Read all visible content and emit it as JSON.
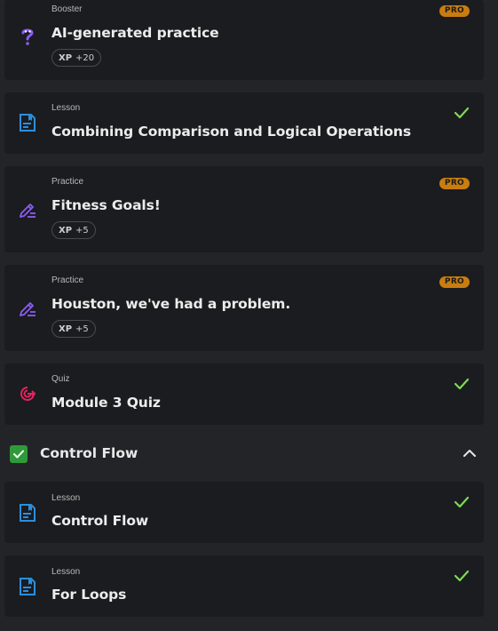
{
  "items": [
    {
      "type": "Booster",
      "title": "AI-generated practice",
      "xp_label": "XP",
      "xp_value": "+20",
      "badge": "PRO"
    },
    {
      "type": "Lesson",
      "title": "Combining Comparison and Logical Operations",
      "completed": true
    },
    {
      "type": "Practice",
      "title": "Fitness Goals!",
      "xp_label": "XP",
      "xp_value": "+5",
      "badge": "PRO"
    },
    {
      "type": "Practice",
      "title": "Houston, we've had a problem.",
      "xp_label": "XP",
      "xp_value": "+5",
      "badge": "PRO"
    },
    {
      "type": "Quiz",
      "title": "Module 3 Quiz",
      "completed": true
    }
  ],
  "section": {
    "title": "Control Flow",
    "completed": true,
    "expanded": true
  },
  "section_items": [
    {
      "type": "Lesson",
      "title": "Control Flow",
      "completed": true
    },
    {
      "type": "Lesson",
      "title": "For Loops",
      "completed": true
    }
  ],
  "colors": {
    "background": "#232427",
    "card": "#1b1c1f",
    "pro_badge": "#c97d10",
    "check": "#7ed957",
    "lesson_icon": "#2a8fe0",
    "practice_icon": "#8b5cf6",
    "quiz_icon": "#e0245e",
    "section_check": "#2f9a3a"
  },
  "icons": {
    "booster": "question-mark-icon",
    "lesson": "lesson-document-icon",
    "practice": "pencil-edit-icon",
    "quiz": "target-icon",
    "completed": "checkmark-icon",
    "collapse": "chevron-up-icon"
  }
}
